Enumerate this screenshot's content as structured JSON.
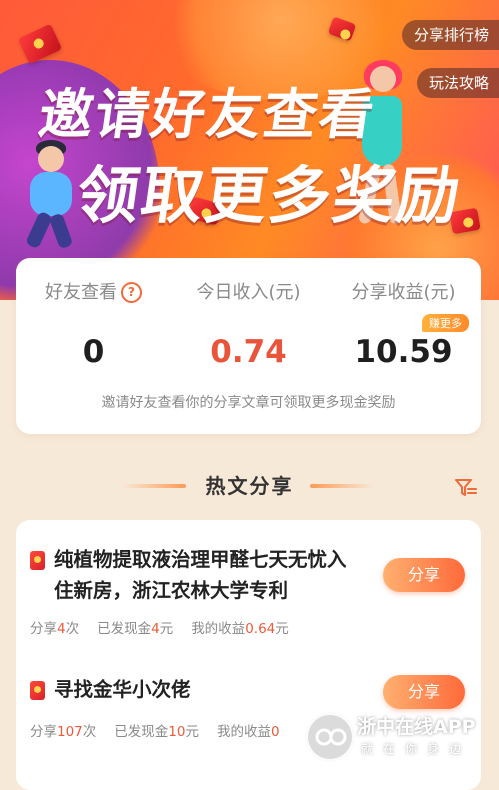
{
  "banner": {
    "headline_line1": "邀请好友查看",
    "headline_line2": "领取更多奖励",
    "share_rank_label": "分享排行榜",
    "how_to_label": "玩法攻略"
  },
  "stats": {
    "items": [
      {
        "label": "好友查看",
        "value": "0"
      },
      {
        "label": "今日收入(元)",
        "value": "0.74"
      },
      {
        "label": "分享收益(元)",
        "value": "10.59",
        "badge": "赚更多"
      }
    ],
    "help_symbol": "?",
    "note": "邀请好友查看你的分享文章可领取更多现金奖励"
  },
  "section": {
    "title": "热文分享"
  },
  "articles": [
    {
      "title": "纯植物提取液治理甲醛七天无忧入住新房，浙江农林大学专利",
      "share_label": "分享",
      "share_text": "分享",
      "share_count": "4",
      "times_unit": "次",
      "cash_text": "已发现金",
      "cash_amount": "4",
      "yuan_unit": "元",
      "earn_text": "我的收益",
      "earn_amount": "0.64"
    },
    {
      "title": "寻找金华小次佬",
      "share_label": "分享",
      "share_text": "分享",
      "share_count": "107",
      "times_unit": "次",
      "cash_text": "已发现金",
      "cash_amount": "10",
      "yuan_unit": "元",
      "earn_text": "我的收益",
      "earn_amount": "0"
    }
  ],
  "watermark": {
    "name": "浙中在线APP",
    "slogan": "就在你身边"
  },
  "colors": {
    "accent": "#ef5a3a",
    "page_bg": "#f7e9d8"
  }
}
